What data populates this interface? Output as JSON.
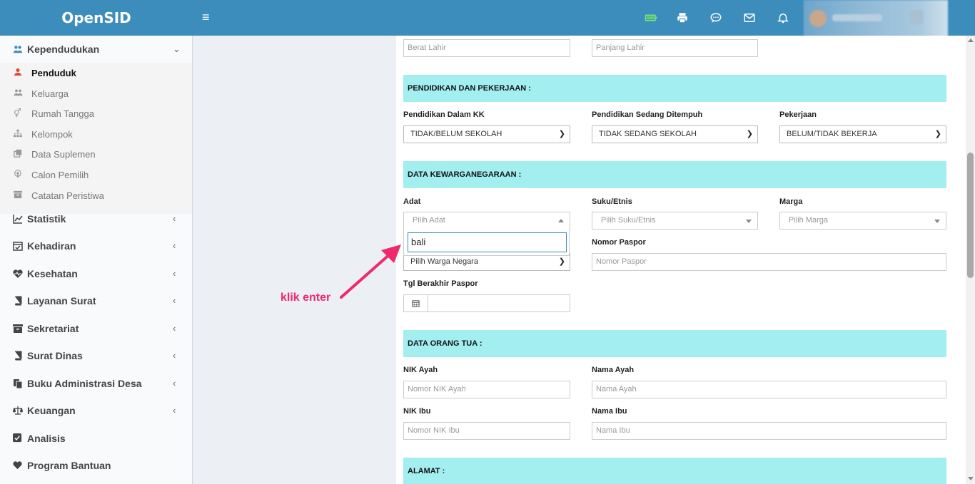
{
  "header": {
    "logo": "OpenSID",
    "icons": [
      "menu-icon",
      "battery-icon",
      "print-icon",
      "chat-icon",
      "mail-icon",
      "bell-icon"
    ]
  },
  "sidebar": {
    "kependudukan": {
      "label": "Kependudukan",
      "items": [
        {
          "label": "Penduduk",
          "icon": "user-icon",
          "active": true
        },
        {
          "label": "Keluarga",
          "icon": "users-icon"
        },
        {
          "label": "Rumah Tangga",
          "icon": "venus-mars-icon"
        },
        {
          "label": "Kelompok",
          "icon": "sitemap-icon"
        },
        {
          "label": "Data Suplemen",
          "icon": "clone-icon"
        },
        {
          "label": "Calon Pemilih",
          "icon": "podcast-icon"
        },
        {
          "label": "Catatan Peristiwa",
          "icon": "archive-icon"
        }
      ]
    },
    "menus": [
      {
        "label": "Statistik",
        "icon": "line-chart-icon"
      },
      {
        "label": "Kehadiran",
        "icon": "calendar-check-icon"
      },
      {
        "label": "Kesehatan",
        "icon": "heartbeat-icon"
      },
      {
        "label": "Layanan Surat",
        "icon": "book-icon"
      },
      {
        "label": "Sekretariat",
        "icon": "archive-icon"
      },
      {
        "label": "Surat Dinas",
        "icon": "book-icon"
      },
      {
        "label": "Buku Administrasi Desa",
        "icon": "files-icon"
      },
      {
        "label": "Keuangan",
        "icon": "balance-scale-icon"
      },
      {
        "label": "Analisis",
        "icon": "check-square-icon"
      },
      {
        "label": "Program Bantuan",
        "icon": "heart-icon"
      }
    ]
  },
  "form": {
    "berat_lahir_placeholder": "Berat Lahir",
    "panjang_lahir_placeholder": "Panjang Lahir",
    "section_pendidikan": "PENDIDIKAN DAN PEKERJAAN :",
    "pendidikan_kk_label": "Pendidikan Dalam KK",
    "pendidikan_kk_value": "TIDAK/BELUM SEKOLAH",
    "pendidikan_tempuh_label": "Pendidikan Sedang Ditempuh",
    "pendidikan_tempuh_value": "TIDAK SEDANG SEKOLAH",
    "pekerjaan_label": "Pekerjaan",
    "pekerjaan_value": "BELUM/TIDAK BEKERJA",
    "section_kewarganegaraan": "DATA KEWARGANEGARAAN :",
    "adat_label": "Adat",
    "adat_placeholder": "Pilih Adat",
    "adat_search_value": "bali",
    "suku_label": "Suku/Etnis",
    "suku_placeholder": "Pilih Suku/Etnis",
    "marga_label": "Marga",
    "marga_placeholder": "Pilih Marga",
    "warga_negara_value": "Pilih Warga Negara",
    "nomor_paspor_label": "Nomor Paspor",
    "nomor_paspor_placeholder": "Nomor Paspor",
    "tgl_paspor_label": "Tgl Berakhir Paspor",
    "section_orang_tua": "DATA ORANG TUA :",
    "nik_ayah_label": "NIK Ayah",
    "nik_ayah_placeholder": "Nomor NIK Ayah",
    "nama_ayah_label": "Nama Ayah",
    "nama_ayah_placeholder": "Nama Ayah",
    "nik_ibu_label": "NIK Ibu",
    "nik_ibu_placeholder": "Nomor NIK Ibu",
    "nama_ibu_label": "Nama Ibu",
    "nama_ibu_placeholder": "Nama Ibu",
    "section_alamat": "ALAMAT :"
  },
  "annotation": {
    "text": "klik enter",
    "color": "#ee2a6b"
  },
  "colors": {
    "header": "#3c8dbc",
    "section": "#a3efef",
    "active_icon": "#dd4b39"
  }
}
